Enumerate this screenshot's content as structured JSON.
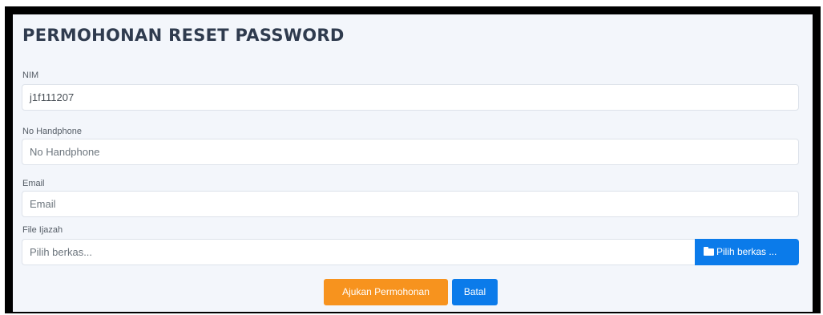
{
  "form": {
    "title": "PERMOHONAN RESET PASSWORD",
    "nim": {
      "label": "NIM",
      "value": "j1f111207"
    },
    "phone": {
      "label": "No Handphone",
      "placeholder": "No Handphone"
    },
    "email": {
      "label": "Email",
      "placeholder": "Email"
    },
    "file": {
      "label": "File Ijazah",
      "placeholder": "Pilih berkas...",
      "button_label": "Pilih berkas ..."
    },
    "submit_label": "Ajukan Permohonan",
    "cancel_label": "Batal"
  },
  "icons": {
    "file_button_icon": "folder-open-icon"
  },
  "colors": {
    "primary": "#0b7bea",
    "submit": "#f7931e",
    "title": "#2f3b4e",
    "background": "#f3f6fb"
  }
}
